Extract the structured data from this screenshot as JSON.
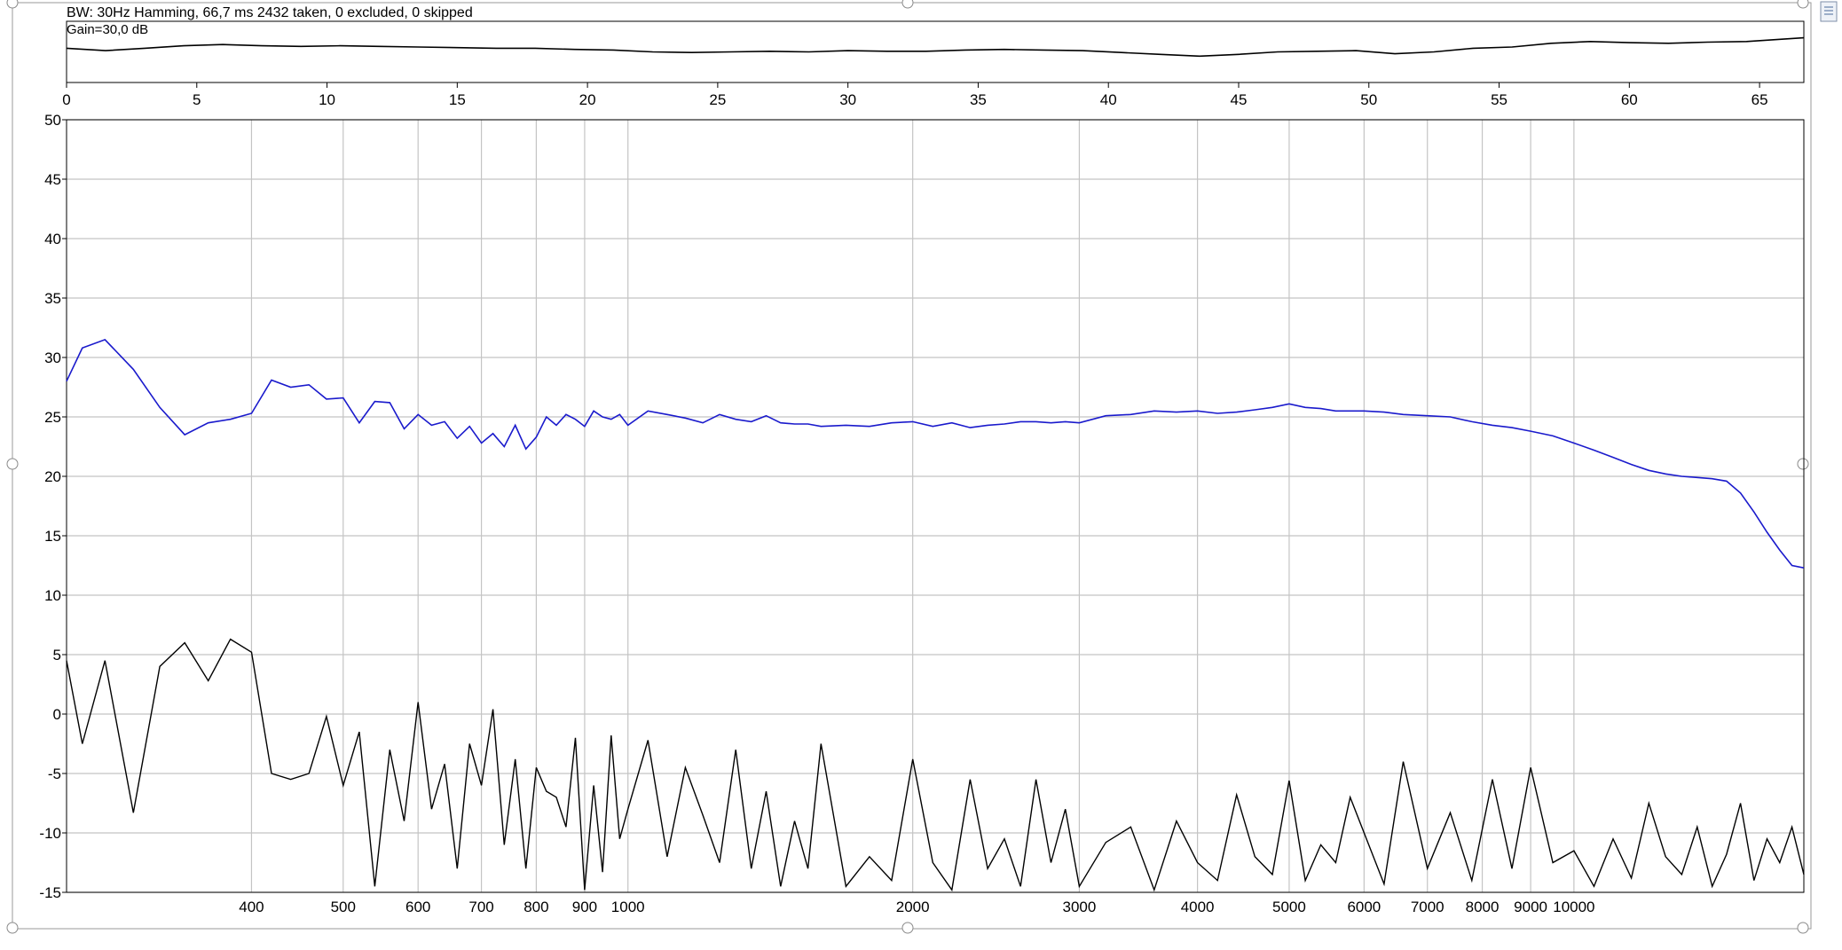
{
  "header": {
    "info": "BW: 30Hz Hamming, 66,7 ms 2432 taken, 0 excluded, 0 skipped",
    "gain": "Gain=30,0 dB"
  },
  "colors": {
    "spectrum": "#1a1acc",
    "noise": "#000000",
    "grid": "#c4c4c4",
    "frame": "#000000",
    "selection_frame": "#9a9a9a"
  },
  "icons": [
    "chart-options-icon",
    "resize-handle-icon"
  ],
  "chart_data": [
    {
      "type": "line",
      "name": "time-strip",
      "xlim": [
        0,
        66.7
      ],
      "x_ticks": [
        0,
        5,
        10,
        15,
        20,
        25,
        30,
        35,
        40,
        45,
        50,
        55,
        60,
        65
      ],
      "x_tick_labels": [
        "0",
        "5",
        "10",
        "15",
        "20",
        "25",
        "30",
        "35",
        "40",
        "45",
        "50",
        "55",
        "60",
        "65"
      ],
      "grid": false,
      "series": [
        {
          "x": [
            0,
            1.5,
            3,
            4.5,
            6,
            7.5,
            9,
            10.5,
            12,
            13.5,
            15,
            16.5,
            18,
            19.5,
            21,
            22.5,
            24,
            25.5,
            27,
            28.5,
            30,
            31.5,
            33,
            34.5,
            36,
            37.5,
            39,
            40.5,
            42,
            43.5,
            45,
            46.5,
            48,
            49.5,
            51,
            52.5,
            54,
            55.5,
            57,
            58.5,
            60,
            61.5,
            63,
            64.5,
            66.7
          ],
          "y": [
            0.56,
            0.52,
            0.56,
            0.6,
            0.62,
            0.6,
            0.59,
            0.6,
            0.59,
            0.58,
            0.57,
            0.56,
            0.56,
            0.54,
            0.53,
            0.5,
            0.49,
            0.5,
            0.51,
            0.5,
            0.52,
            0.51,
            0.51,
            0.53,
            0.54,
            0.53,
            0.52,
            0.49,
            0.46,
            0.43,
            0.46,
            0.5,
            0.51,
            0.52,
            0.47,
            0.5,
            0.56,
            0.58,
            0.64,
            0.67,
            0.65,
            0.64,
            0.66,
            0.67,
            0.73
          ]
        }
      ]
    },
    {
      "type": "line",
      "name": "spectrum",
      "xscale": "log",
      "xlim": [
        255,
        17500
      ],
      "ylim": [
        -15,
        50
      ],
      "x_ticks": [
        400,
        500,
        600,
        700,
        800,
        900,
        1000,
        2000,
        3000,
        4000,
        5000,
        6000,
        7000,
        8000,
        9000,
        10000
      ],
      "x_tick_labels": [
        "400",
        "500",
        "600",
        "700",
        "800",
        "900",
        "1000",
        "2000",
        "3000",
        "4000",
        "5000",
        "6000",
        "7000",
        "8000",
        "9000",
        "10000"
      ],
      "y_ticks": [
        -15,
        -10,
        -5,
        0,
        5,
        10,
        15,
        20,
        25,
        30,
        35,
        40,
        45,
        50
      ],
      "y_tick_labels": [
        "-15",
        "-10",
        "-5",
        "0",
        "5",
        "10",
        "15",
        "20",
        "25",
        "30",
        "35",
        "40",
        "45",
        "50"
      ],
      "grid": true,
      "series": [
        {
          "x": [
            255,
            265,
            280,
            300,
            320,
            340,
            360,
            380,
            400,
            420,
            440,
            460,
            480,
            500,
            520,
            540,
            560,
            580,
            600,
            620,
            640,
            660,
            680,
            700,
            720,
            740,
            760,
            780,
            800,
            820,
            840,
            860,
            880,
            900,
            920,
            940,
            960,
            980,
            1000,
            1050,
            1100,
            1150,
            1200,
            1250,
            1300,
            1350,
            1400,
            1450,
            1500,
            1550,
            1600,
            1700,
            1800,
            1900,
            2000,
            2100,
            2200,
            2300,
            2400,
            2500,
            2600,
            2700,
            2800,
            2900,
            3000,
            3200,
            3400,
            3600,
            3800,
            4000,
            4200,
            4400,
            4600,
            4800,
            5000,
            5200,
            5400,
            5600,
            5800,
            6000,
            6300,
            6600,
            7000,
            7400,
            7800,
            8200,
            8600,
            9000,
            9500,
            10000,
            10500,
            11000,
            11500,
            12000,
            12500,
            13000,
            13500,
            14000,
            14500,
            15000,
            15500,
            16000,
            16500,
            17000,
            17500
          ],
          "y": [
            28,
            30.8,
            31.5,
            29,
            25.8,
            23.5,
            24.5,
            24.8,
            25.3,
            28.1,
            27.5,
            27.7,
            26.5,
            26.6,
            24.5,
            26.3,
            26.2,
            24,
            25.2,
            24.3,
            24.6,
            23.2,
            24.2,
            22.8,
            23.6,
            22.5,
            24.3,
            22.3,
            23.3,
            25,
            24.3,
            25.2,
            24.8,
            24.2,
            25.5,
            25,
            24.8,
            25.2,
            24.3,
            25.5,
            25.2,
            24.9,
            24.5,
            25.2,
            24.8,
            24.6,
            25.1,
            24.5,
            24.4,
            24.4,
            24.2,
            24.3,
            24.2,
            24.5,
            24.6,
            24.2,
            24.5,
            24.1,
            24.3,
            24.4,
            24.6,
            24.6,
            24.5,
            24.6,
            24.5,
            25.1,
            25.2,
            25.5,
            25.4,
            25.5,
            25.3,
            25.4,
            25.6,
            25.8,
            26.1,
            25.8,
            25.7,
            25.5,
            25.5,
            25.5,
            25.4,
            25.2,
            25.1,
            25,
            24.6,
            24.3,
            24.1,
            23.8,
            23.4,
            22.8,
            22.2,
            21.6,
            21,
            20.5,
            20.2,
            20,
            19.9,
            19.8,
            19.6,
            18.6,
            17,
            15.3,
            13.8,
            12.5,
            12.3
          ]
        },
        {
          "x": [
            255,
            265,
            280,
            300,
            320,
            340,
            360,
            380,
            400,
            420,
            440,
            460,
            480,
            500,
            520,
            540,
            560,
            580,
            600,
            620,
            640,
            660,
            680,
            700,
            720,
            740,
            760,
            780,
            800,
            820,
            840,
            860,
            880,
            900,
            920,
            940,
            960,
            980,
            1000,
            1050,
            1100,
            1150,
            1200,
            1250,
            1300,
            1350,
            1400,
            1450,
            1500,
            1550,
            1600,
            1700,
            1800,
            1900,
            2000,
            2100,
            2200,
            2300,
            2400,
            2500,
            2600,
            2700,
            2800,
            2900,
            3000,
            3200,
            3400,
            3600,
            3800,
            4000,
            4200,
            4400,
            4600,
            4800,
            5000,
            5200,
            5400,
            5600,
            5800,
            6000,
            6300,
            6600,
            7000,
            7400,
            7800,
            8200,
            8600,
            9000,
            9500,
            10000,
            10500,
            11000,
            11500,
            12000,
            12500,
            13000,
            13500,
            14000,
            14500,
            15000,
            15500,
            16000,
            16500,
            17000,
            17500
          ],
          "y": [
            4.5,
            -2.5,
            4.5,
            -8.3,
            4,
            6,
            2.8,
            6.3,
            5.2,
            -5,
            -5.5,
            -5,
            -0.2,
            -6,
            -1.5,
            -14.5,
            -3,
            -9,
            1,
            -8,
            -4.2,
            -13,
            -2.5,
            -6,
            0.4,
            -11,
            -3.8,
            -13,
            -4.5,
            -6.5,
            -7,
            -9.5,
            -2,
            -14.8,
            -6,
            -13.3,
            -1.8,
            -10.5,
            -8,
            -2.2,
            -12,
            -4.5,
            -8.5,
            -12.5,
            -3,
            -13,
            -6.5,
            -14.5,
            -9,
            -13,
            -2.5,
            -14.5,
            -12,
            -14,
            -3.8,
            -12.5,
            -14.8,
            -5.5,
            -13,
            -10.5,
            -14.5,
            -5.5,
            -12.5,
            -8,
            -14.5,
            -10.8,
            -9.5,
            -14.8,
            -9,
            -12.5,
            -14,
            -6.8,
            -12,
            -13.5,
            -5.6,
            -14,
            -11,
            -12.5,
            -7,
            -10,
            -14.3,
            -4,
            -13,
            -8.3,
            -14,
            -5.5,
            -13,
            -4.5,
            -12.5,
            -11.5,
            -14.5,
            -10.5,
            -13.8,
            -7.5,
            -12,
            -13.5,
            -9.5,
            -14.5,
            -11.8,
            -7.5,
            -14,
            -10.5,
            -12.5,
            -9.5,
            -13.5
          ]
        }
      ]
    }
  ]
}
